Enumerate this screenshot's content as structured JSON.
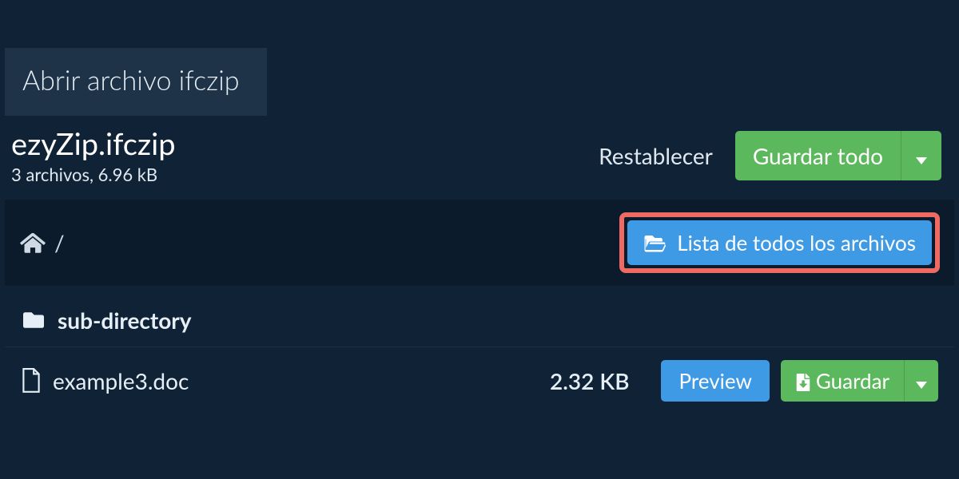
{
  "tab": {
    "label": "Abrir archivo ifczip"
  },
  "file": {
    "name": "ezyZip.ifczip",
    "meta": "3 archivos, 6.96 kB"
  },
  "actions": {
    "reset": "Restablecer",
    "saveAll": "Guardar todo",
    "listAll": "Lista de todos los archivos",
    "preview": "Preview",
    "save": "Guardar"
  },
  "breadcrumb": {
    "separator": "/"
  },
  "rows": [
    {
      "type": "dir",
      "name": "sub-directory"
    },
    {
      "type": "file",
      "name": "example3.doc",
      "size": "2.32 KB"
    }
  ]
}
